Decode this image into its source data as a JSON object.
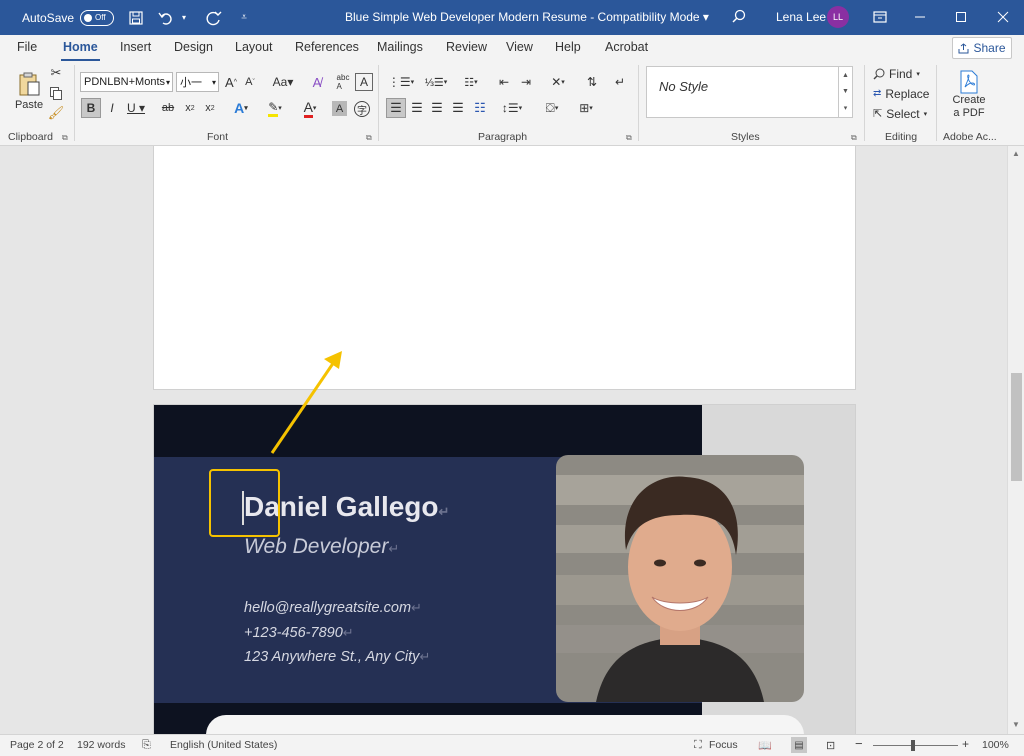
{
  "titlebar": {
    "autosave_label": "AutoSave",
    "autosave_state": "Off",
    "document_title": "Blue Simple Web Developer Modern Resume  -  Compatibility Mode  ▾",
    "user_name": "Lena Lee",
    "user_initials": "LL"
  },
  "tabs": [
    "File",
    "Home",
    "Insert",
    "Design",
    "Layout",
    "References",
    "Mailings",
    "Review",
    "View",
    "Help",
    "Acrobat"
  ],
  "share_label": "Share",
  "ribbon": {
    "paste_label": "Paste",
    "font_name": "PDNLBN+Monts",
    "font_size": "小一",
    "styles_text": "No Style",
    "find_label": "Find",
    "replace_label": "Replace",
    "select_label": "Select",
    "create_pdf_line1": "Create",
    "create_pdf_line2": "a PDF",
    "groups": {
      "clipboard": "Clipboard",
      "font": "Font",
      "paragraph": "Paragraph",
      "styles": "Styles",
      "editing": "Editing",
      "adobe": "Adobe Ac..."
    }
  },
  "resume": {
    "name": "Daniel Gallego",
    "title": "Web Developer",
    "email": "hello@reallygreatsite.com",
    "phone": "+123-456-7890",
    "address": "123 Anywhere St., Any City"
  },
  "statusbar": {
    "page": "Page 2 of 2",
    "words": "192 words",
    "language": "English (United States)",
    "focus": "Focus",
    "zoom": "100%"
  },
  "colors": {
    "brand": "#2b579a",
    "resume_navy": "#253054",
    "resume_dark": "#0d1220",
    "annotation": "#f5c200"
  }
}
